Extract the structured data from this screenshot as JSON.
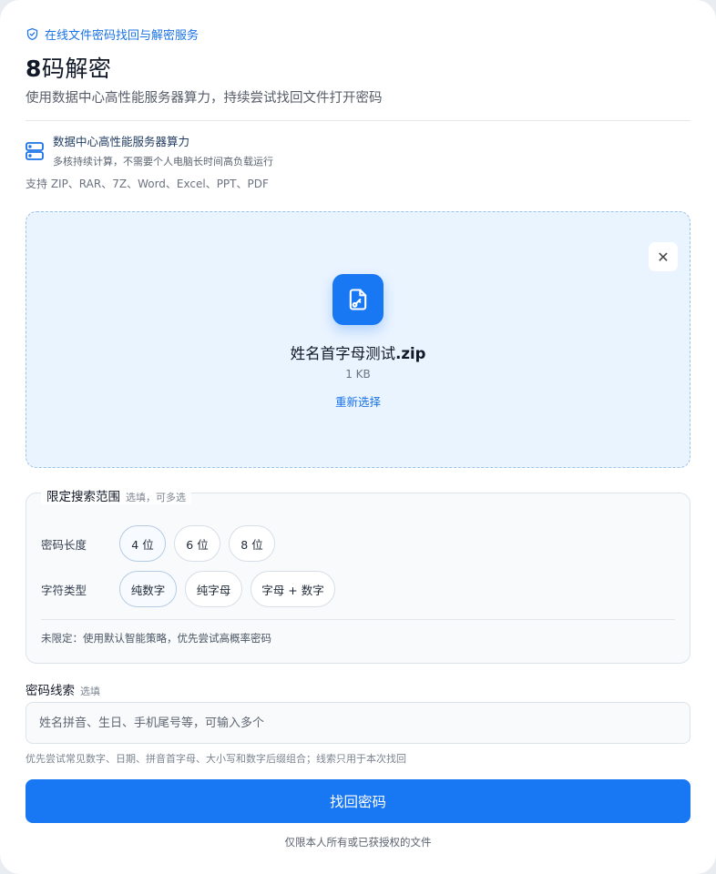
{
  "header": {
    "badge_icon": "shield-check-icon",
    "badge_text": "在线文件密码找回与解密服务",
    "title_num": "8",
    "title_rest": "码解密",
    "subtitle": "使用数据中心高性能服务器算力，持续尝试找回文件打开密码"
  },
  "feature": {
    "icon": "server-icon",
    "title": "数据中心高性能服务器算力",
    "desc": "多核持续计算，不需要个人电脑长时间高负载运行"
  },
  "formats": "支持 ZIP、RAR、7Z、Word、Excel、PPT、PDF",
  "upload": {
    "file_icon": "file-key-icon",
    "file_base": "姓名首字母测试",
    "file_ext": ".zip",
    "file_size": "1 KB",
    "reselect": "重新选择",
    "close_glyph": "✕"
  },
  "range": {
    "title": "限定搜索范围",
    "hint": "选填，可多选",
    "length_label": "密码长度",
    "length_options": [
      "4 位",
      "6 位",
      "8 位"
    ],
    "type_label": "字符类型",
    "type_options": [
      "纯数字",
      "纯字母",
      "字母 + 数字"
    ],
    "note": "未限定：使用默认智能策略，优先尝试高概率密码"
  },
  "clue": {
    "label": "密码线索",
    "optional": "选填",
    "placeholder": "姓名拼音、生日、手机尾号等，可输入多个",
    "note": "优先尝试常见数字、日期、拼音首字母、大小写和数字后缀组合；线索只用于本次找回"
  },
  "submit_label": "找回密码",
  "footer": "仅限本人所有或已获授权的文件",
  "colors": {
    "accent": "#1877f2",
    "link": "#1a73e8",
    "dropzone_bg": "#eaf4ff"
  }
}
